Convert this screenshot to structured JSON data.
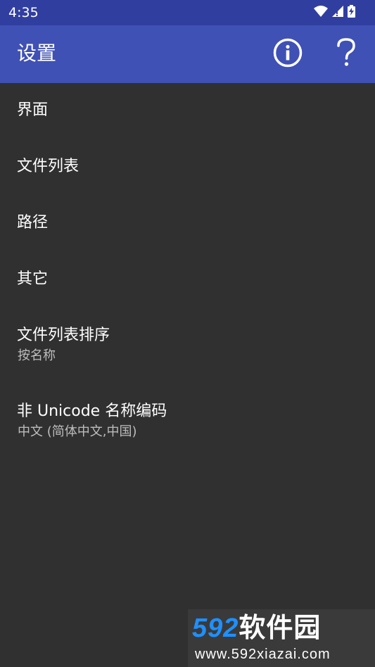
{
  "status_bar": {
    "time": "4:35"
  },
  "toolbar": {
    "title": "设置",
    "info_icon": "info-circle-icon",
    "help_icon": "question-mark-icon"
  },
  "preferences": [
    {
      "title": "界面"
    },
    {
      "title": "文件列表"
    },
    {
      "title": "路径"
    },
    {
      "title": "其它"
    },
    {
      "title": "文件列表排序",
      "summary": "按名称"
    },
    {
      "title": "非 Unicode 名称编码",
      "summary": "中文 (简体中文,中国)"
    }
  ],
  "watermark": {
    "digits": "592",
    "name": "软件园",
    "url": "www.592xiazai.com"
  },
  "colors": {
    "status_bar": "#303F9F",
    "toolbar": "#3F51B5",
    "background": "#303030",
    "watermark_blue": "#1E90FF"
  }
}
